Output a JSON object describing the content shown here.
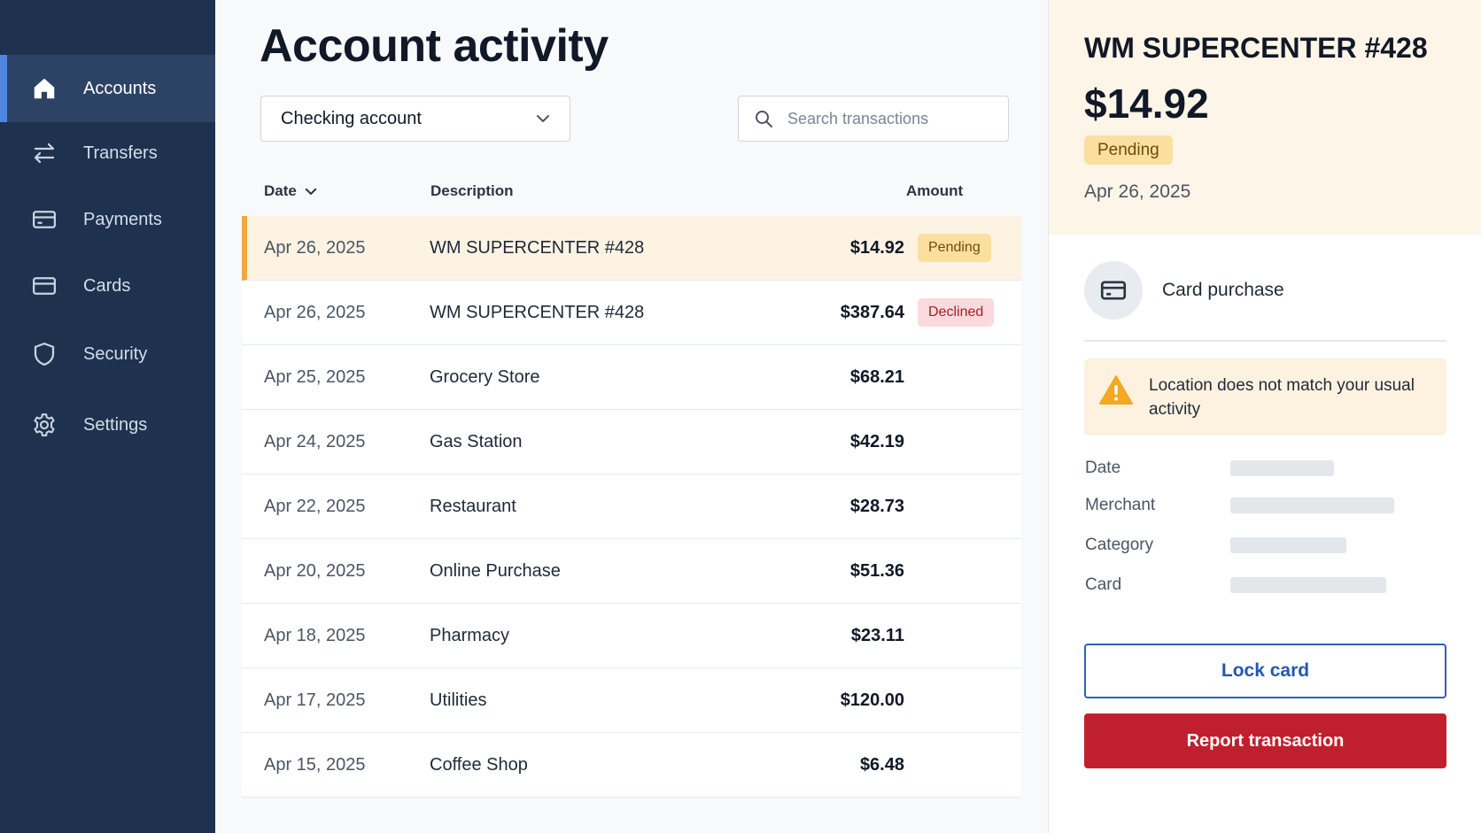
{
  "sidebar": {
    "items": [
      {
        "label": "Accounts",
        "icon": "home-icon",
        "active": true
      },
      {
        "label": "Transfers",
        "icon": "transfer-arrows-icon"
      },
      {
        "label": "Payments",
        "icon": "payment-card-icon"
      },
      {
        "label": "Cards",
        "icon": "credit-card-icon"
      },
      {
        "label": "Security",
        "icon": "shield-icon"
      },
      {
        "label": "Settings",
        "icon": "gear-icon"
      }
    ]
  },
  "main": {
    "title": "Account activity",
    "account_select": {
      "value": "Checking account"
    },
    "search": {
      "placeholder": "Search transactions"
    },
    "columns": {
      "date": "Date",
      "description": "Description",
      "amount": "Amount"
    },
    "sort": {
      "column": "Date",
      "direction": "descending"
    },
    "transactions": [
      {
        "date": "Apr 26, 2025",
        "description": "WM SUPERCENTER #428",
        "amount": "$14.92",
        "status": "Pending",
        "selected": true
      },
      {
        "date": "Apr 26, 2025",
        "description": "WM SUPERCENTER #428",
        "amount": "$387.64",
        "status": "Declined"
      },
      {
        "date": "Apr 25, 2025",
        "description": "Grocery Store",
        "amount": "$68.21"
      },
      {
        "date": "Apr 24, 2025",
        "description": "Gas Station",
        "amount": "$42.19"
      },
      {
        "date": "Apr 22, 2025",
        "description": "Restaurant",
        "amount": "$28.73"
      },
      {
        "date": "Apr 20, 2025",
        "description": "Online Purchase",
        "amount": "$51.36"
      },
      {
        "date": "Apr 18, 2025",
        "description": "Pharmacy",
        "amount": "$23.11"
      },
      {
        "date": "Apr 17, 2025",
        "description": "Utilities",
        "amount": "$120.00"
      },
      {
        "date": "Apr 15, 2025",
        "description": "Coffee Shop",
        "amount": "$6.48"
      }
    ]
  },
  "detail": {
    "merchant": "WM SUPERCENTER #428",
    "amount": "$14.92",
    "status": "Pending",
    "date": "Apr 26, 2025",
    "type_label": "Card purchase",
    "type_icon": "credit-card-icon",
    "alert_icon": "warning-triangle-icon",
    "alert_text": "Location does not match your usual activity",
    "fields": {
      "date": "Date",
      "merchant": "Merchant",
      "category": "Category",
      "card": "Card"
    },
    "lock_button": "Lock card",
    "report_button": "Report transaction"
  },
  "colors": {
    "sidebar_bg": "#1e3250",
    "sidebar_active": "#2c4365",
    "accent_blue": "#2b62b8",
    "pending": "#fbdf9e",
    "declined": "#fadadd",
    "danger": "#c0202d",
    "selected_row_bar": "#f0a93a"
  }
}
